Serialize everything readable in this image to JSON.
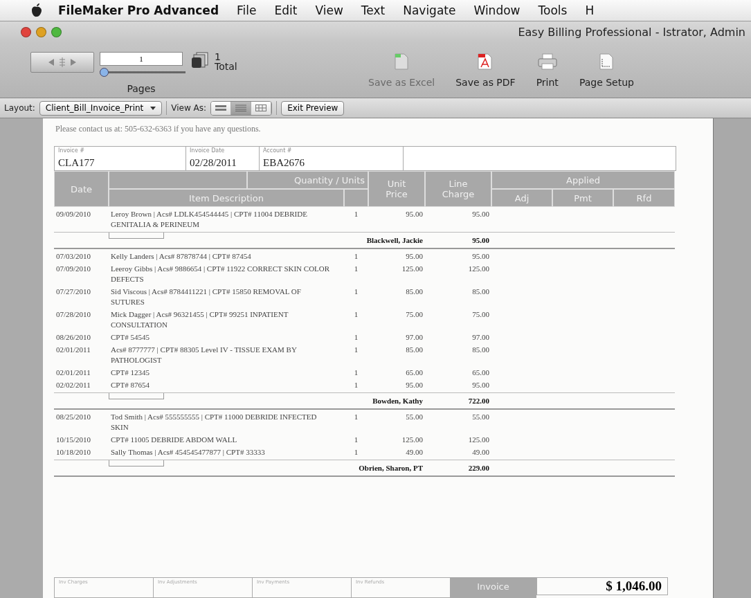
{
  "menubar": {
    "items": [
      {
        "label": "FileMaker Pro Advanced",
        "kind": "app"
      },
      {
        "label": "File",
        "kind": "menu"
      },
      {
        "label": "Edit",
        "kind": "menu"
      },
      {
        "label": "View",
        "kind": "menu"
      },
      {
        "label": "Text",
        "kind": "menu"
      },
      {
        "label": "Navigate",
        "kind": "menu"
      },
      {
        "label": "Window",
        "kind": "menu"
      },
      {
        "label": "Tools",
        "kind": "menu"
      },
      {
        "label": "H",
        "kind": "menu"
      }
    ]
  },
  "window": {
    "title": "Easy Billing Professional - Istrator, Admin"
  },
  "toolbar": {
    "page_field": {
      "value": "1"
    },
    "page_count": "1",
    "page_count_label": "Total",
    "pages_label": "Pages",
    "slider": {
      "level": 0
    },
    "buttons": [
      {
        "label": "Save as Excel",
        "kind": "excel",
        "disabled": true
      },
      {
        "label": "Save as PDF",
        "kind": "pdf",
        "disabled": false
      },
      {
        "label": "Print",
        "kind": "print",
        "disabled": false
      },
      {
        "label": "Page Setup",
        "kind": "setup",
        "disabled": false
      }
    ]
  },
  "layout_bar": {
    "layout_label": "Layout:",
    "layout": "Client_Bill_Invoice_Print",
    "view_as_label": "View As:",
    "view_buttons": [
      {
        "kind": "form",
        "selected": false
      },
      {
        "kind": "list",
        "selected": true
      },
      {
        "kind": "table",
        "selected": false
      }
    ],
    "exit_button": "Exit Preview"
  },
  "invoice": {
    "contact": "Please contact us at: 505-632-6363 if you have any questions.",
    "fields": [
      {
        "label": "Invoice #",
        "value": "CLA177"
      },
      {
        "label": "Invoice Date",
        "value": "02/28/2011"
      },
      {
        "label": "Account #",
        "value": "EBA2676"
      }
    ],
    "columns": {
      "date": "Date",
      "quantity": "Quantity / Units",
      "description": "Item Description",
      "unit_price": "Unit Price",
      "line_charge": "Line Charge",
      "applied": "Applied",
      "adj": "Adj",
      "pmt": "Pmt",
      "rfd": "Rfd"
    },
    "groups": [
      {
        "rows": [
          {
            "date": "09/09/2010",
            "description": "Leroy Brown | Acs# LDLK454544445 | CPT# 11004 DEBRIDE GENITALIA & PERINEUM",
            "quantity": "1",
            "unit_price": "95.00",
            "line_charge": "95.00"
          }
        ],
        "provider": "Blackwell, Jackie",
        "total": "95.00"
      },
      {
        "rows": [
          {
            "date": "07/03/2010",
            "description": "Kelly Landers | Acs# 87878744 | CPT# 87454",
            "quantity": "1",
            "unit_price": "95.00",
            "line_charge": "95.00"
          },
          {
            "date": "07/09/2010",
            "description": "Leeroy Gibbs | Acs# 9886654 | CPT# 11922 CORRECT SKIN COLOR DEFECTS",
            "quantity": "1",
            "unit_price": "125.00",
            "line_charge": "125.00"
          },
          {
            "date": "07/27/2010",
            "description": "Sid Viscous | Acs# 8784411221 | CPT# 15850 REMOVAL OF SUTURES",
            "quantity": "1",
            "unit_price": "85.00",
            "line_charge": "85.00"
          },
          {
            "date": "07/28/2010",
            "description": "Mick Dagger | Acs# 96321455 | CPT# 99251 INPATIENT CONSULTATION",
            "quantity": "1",
            "unit_price": "75.00",
            "line_charge": "75.00"
          },
          {
            "date": "08/26/2010",
            "description": "CPT# 54545",
            "quantity": "1",
            "unit_price": "97.00",
            "line_charge": "97.00"
          },
          {
            "date": "02/01/2011",
            "description": "Acs# 8777777 | CPT# 88305 Level IV - TISSUE EXAM BY PATHOLOGIST",
            "quantity": "1",
            "unit_price": "85.00",
            "line_charge": "85.00"
          },
          {
            "date": "02/01/2011",
            "description": "CPT# 12345",
            "quantity": "1",
            "unit_price": "65.00",
            "line_charge": "65.00"
          },
          {
            "date": "02/02/2011",
            "description": "CPT# 87654",
            "quantity": "1",
            "unit_price": "95.00",
            "line_charge": "95.00"
          }
        ],
        "provider": "Bowden, Kathy",
        "total": "722.00"
      },
      {
        "rows": [
          {
            "date": "08/25/2010",
            "description": "Tod Smith | Acs# 555555555 | CPT# 11000 DEBRIDE INFECTED SKIN",
            "quantity": "1",
            "unit_price": "55.00",
            "line_charge": "55.00"
          },
          {
            "date": "10/15/2010",
            "description": "CPT# 11005 DEBRIDE ABDOM WALL",
            "quantity": "1",
            "unit_price": "125.00",
            "line_charge": "125.00"
          },
          {
            "date": "10/18/2010",
            "description": "Sally Thomas | Acs# 454545477877 | CPT# 33333",
            "quantity": "1",
            "unit_price": "49.00",
            "line_charge": "49.00"
          }
        ],
        "provider": "Obrien, Sharon, PT",
        "total": "229.00"
      }
    ],
    "footer": {
      "labels": [
        "Inv Charges",
        "Inv Adjustments",
        "Inv Payments",
        "Inv Refunds"
      ],
      "total_label": "Invoice",
      "total": "$ 1,046.00"
    }
  }
}
